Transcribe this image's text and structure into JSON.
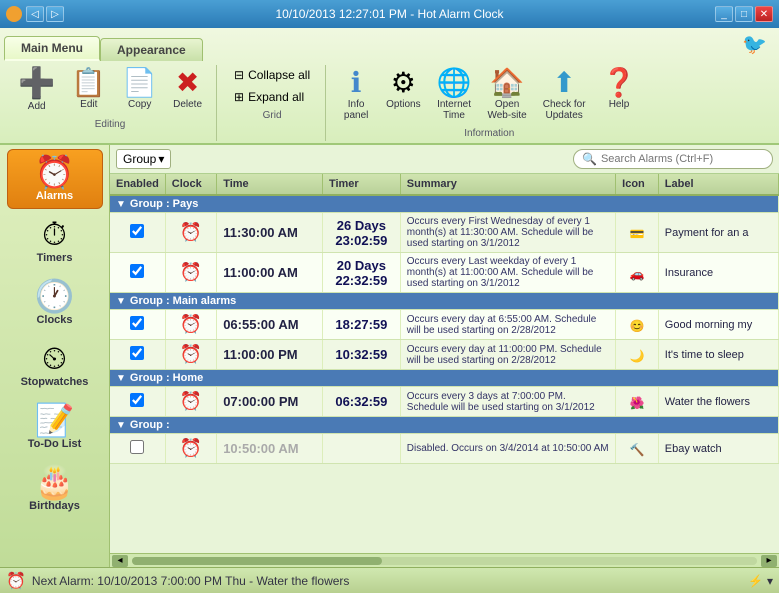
{
  "titlebar": {
    "title": "10/10/2013 12:27:01 PM - Hot Alarm Clock",
    "icon": "🔔",
    "controls": [
      "_",
      "□",
      "✕"
    ]
  },
  "quicktoolbar": {
    "buttons": [
      "⊕",
      "◁",
      "▷"
    ]
  },
  "ribbon": {
    "tabs": [
      {
        "id": "main-menu",
        "label": "Main Menu",
        "active": true
      },
      {
        "id": "appearance",
        "label": "Appearance",
        "active": false
      }
    ],
    "groups": [
      {
        "id": "editing",
        "label": "Editing",
        "buttons": [
          {
            "id": "add",
            "icon": "➕",
            "label": "Add",
            "color": "#20a030"
          },
          {
            "id": "edit",
            "icon": "📋",
            "label": "Edit"
          },
          {
            "id": "copy",
            "icon": "📄",
            "label": "Copy"
          },
          {
            "id": "delete",
            "icon": "✖",
            "label": "Delete",
            "color": "#cc2020"
          }
        ]
      },
      {
        "id": "grid",
        "label": "Grid",
        "buttons_small": [
          {
            "id": "collapse-all",
            "icon": "⊟",
            "label": "Collapse all"
          },
          {
            "id": "expand-all",
            "icon": "⊞",
            "label": "Expand all"
          }
        ]
      },
      {
        "id": "information",
        "label": "Information",
        "buttons": [
          {
            "id": "info-panel",
            "icon": "ℹ",
            "label": "Info\npanel"
          },
          {
            "id": "options",
            "icon": "⚙",
            "label": "Options"
          },
          {
            "id": "internet-time",
            "icon": "🌐",
            "label": "Internet\nTime"
          },
          {
            "id": "open-website",
            "icon": "🏠",
            "label": "Open\nWeb-site"
          },
          {
            "id": "check-updates",
            "icon": "⬆",
            "label": "Check for\nUpdates"
          },
          {
            "id": "help",
            "icon": "❓",
            "label": "Help"
          }
        ]
      }
    ]
  },
  "sidebar": {
    "items": [
      {
        "id": "alarms",
        "icon": "⏰",
        "label": "Alarms",
        "active": true
      },
      {
        "id": "timers",
        "icon": "⏱",
        "label": "Timers",
        "active": false
      },
      {
        "id": "clocks",
        "icon": "🕐",
        "label": "Clocks",
        "active": false
      },
      {
        "id": "stopwatches",
        "icon": "⏲",
        "label": "Stopwatches",
        "active": false
      },
      {
        "id": "todolist",
        "icon": "📝",
        "label": "To-Do List",
        "active": false
      },
      {
        "id": "birthdays",
        "icon": "🎂",
        "label": "Birthdays",
        "active": false
      }
    ]
  },
  "toolbar": {
    "group_label": "Group",
    "search_placeholder": "Search Alarms (Ctrl+F)"
  },
  "table": {
    "headers": [
      "Enabled",
      "Clock",
      "Time",
      "Timer",
      "Summary",
      "Icon",
      "Label"
    ],
    "groups": [
      {
        "id": "pays",
        "label": "Group : Pays",
        "rows": [
          {
            "enabled": true,
            "has_clock": true,
            "time": "11:30:00 AM",
            "timer": "26 Days\n23:02:59",
            "summary": "Occurs every First Wednesday of every 1 month(s) at 11:30:00 AM. Schedule will be used starting on 3/1/2012",
            "icon": "💳",
            "label": "Payment for an a"
          },
          {
            "enabled": true,
            "has_clock": true,
            "time": "11:00:00 AM",
            "timer": "20 Days\n22:32:59",
            "summary": "Occurs every Last weekday of every 1 month(s) at 11:00:00 AM. Schedule will be used starting on 3/1/2012",
            "icon": "🚗",
            "label": "Insurance"
          }
        ]
      },
      {
        "id": "main-alarms",
        "label": "Group : Main alarms",
        "rows": [
          {
            "enabled": true,
            "has_clock": true,
            "time": "06:55:00 AM",
            "timer": "18:27:59",
            "summary": "Occurs every day at 6:55:00 AM. Schedule will be used starting on 2/28/2012",
            "icon": "😊",
            "label": "Good morning my"
          },
          {
            "enabled": true,
            "has_clock": true,
            "time": "11:00:00 PM",
            "timer": "10:32:59",
            "summary": "Occurs every day at 11:00:00 PM. Schedule will be used starting on 2/28/2012",
            "icon": "🌙",
            "label": "It's time to sleep"
          }
        ]
      },
      {
        "id": "home",
        "label": "Group : Home",
        "rows": [
          {
            "enabled": true,
            "has_clock": true,
            "time": "07:00:00 PM",
            "timer": "06:32:59",
            "summary": "Occurs every 3 days at 7:00:00 PM. Schedule will be used starting on 3/1/2012",
            "icon": "🌺",
            "label": "Water the flowers"
          }
        ]
      },
      {
        "id": "group-empty",
        "label": "Group :",
        "rows": [
          {
            "enabled": false,
            "has_clock": true,
            "time": "10:50:00 AM",
            "timer": "",
            "summary": "Disabled. Occurs on 3/4/2014 at 10:50:00 AM",
            "icon": "🔨",
            "label": "Ebay watch"
          }
        ]
      }
    ]
  },
  "statusbar": {
    "text": "Next Alarm: 10/10/2013 7:00:00 PM Thu - Water the flowers",
    "icon": "⚡"
  }
}
